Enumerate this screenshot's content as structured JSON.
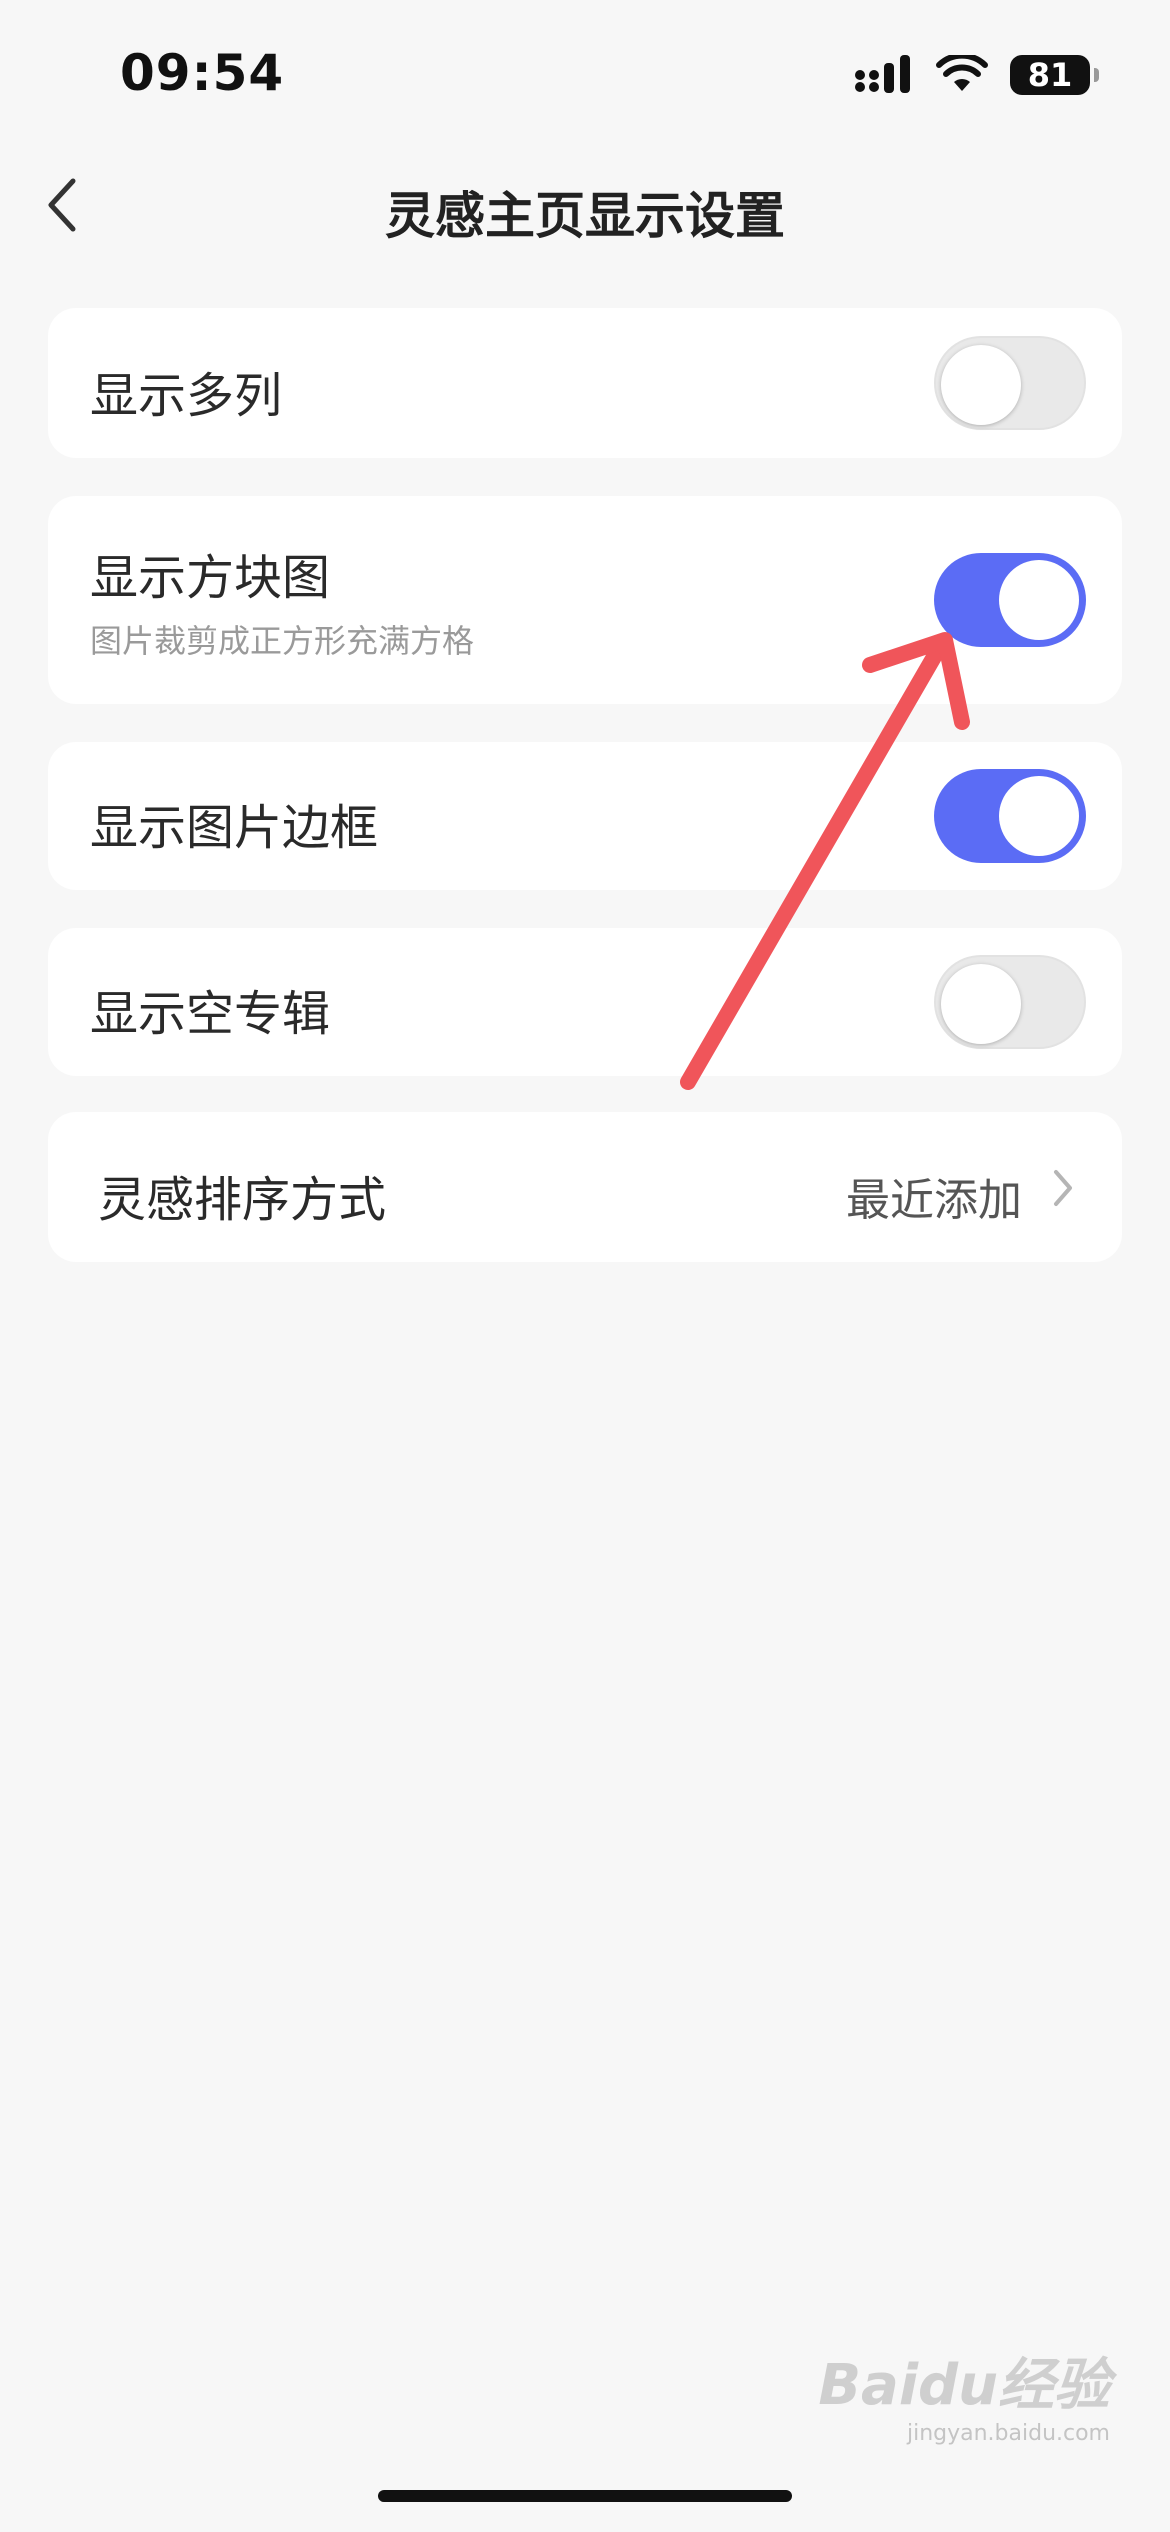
{
  "status_bar": {
    "time": "09:54",
    "battery": "81",
    "signal_icon": "cellular-signal-icon",
    "wifi_icon": "wifi-icon"
  },
  "header": {
    "title": "灵感主页显示设置",
    "back_icon": "chevron-left-icon"
  },
  "settings": {
    "show_multi_column": {
      "label": "显示多列",
      "enabled": false
    },
    "show_square": {
      "label": "显示方块图",
      "subtitle": "图片裁剪成正方形充满方格",
      "enabled": true
    },
    "show_border": {
      "label": "显示图片边框",
      "enabled": true
    },
    "show_empty_album": {
      "label": "显示空专辑",
      "enabled": false
    },
    "sort_order": {
      "label": "灵感排序方式",
      "value": "最近添加",
      "icon": "chevron-right-icon"
    }
  },
  "colors": {
    "toggle_on": "#5b6cf5",
    "toggle_off": "#e9e9e9",
    "annotation_arrow": "#f0555a",
    "background": "#f7f7f7"
  },
  "watermark": {
    "brand": "Baidu经验",
    "sub": "jingyan.baidu.com"
  }
}
